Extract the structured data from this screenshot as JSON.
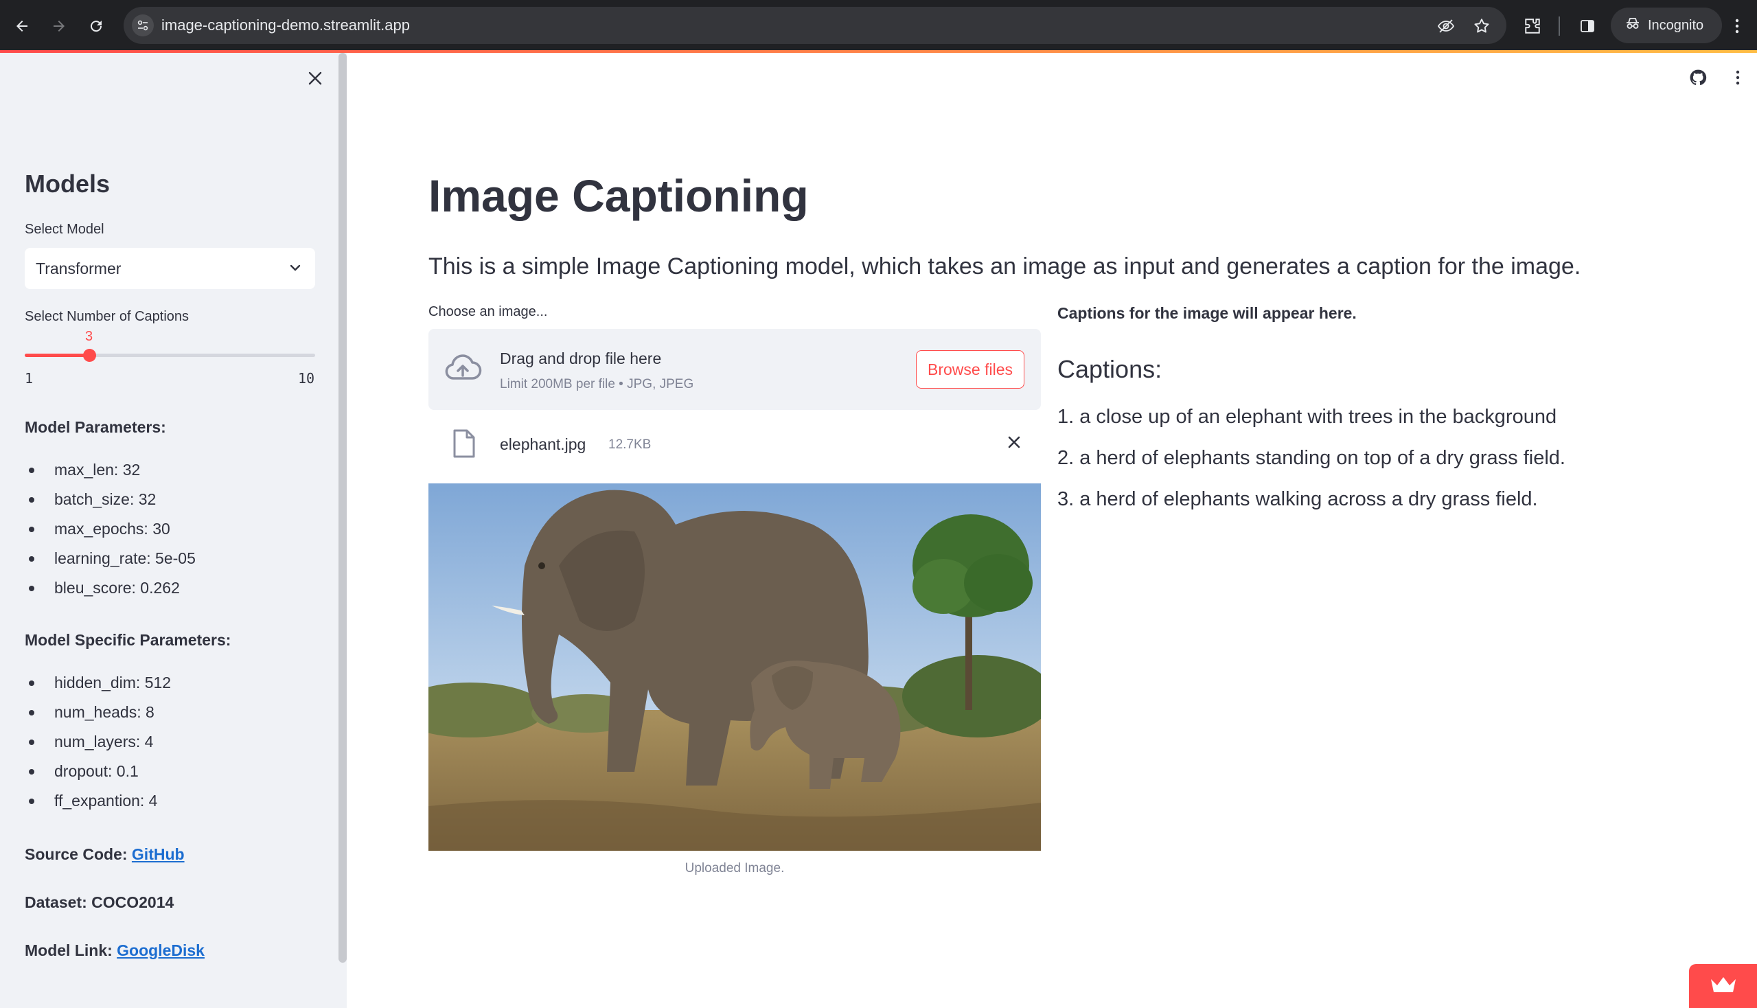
{
  "browser": {
    "url": "image-captioning-demo.streamlit.app",
    "profile_label": "Incognito",
    "icons": [
      "back-arrow-icon",
      "forward-arrow-icon",
      "reload-icon",
      "site-info-icon",
      "eye-off-icon",
      "star-icon",
      "extensions-icon",
      "side-panel-icon",
      "incognito-icon",
      "kebab-menu-icon"
    ]
  },
  "sidebar": {
    "heading": "Models",
    "select_model": {
      "label": "Select Model",
      "value": "Transformer"
    },
    "captions_slider": {
      "label": "Select Number of Captions",
      "value": 3,
      "value_text": "3",
      "min": 1,
      "max": 10,
      "min_text": "1",
      "max_text": "10"
    },
    "model_params": {
      "heading": "Model Parameters:",
      "items": [
        "max_len: 32",
        "batch_size: 32",
        "max_epochs: 30",
        "learning_rate: 5e-05",
        "bleu_score: 0.262"
      ]
    },
    "specific_params": {
      "heading": "Model Specific Parameters:",
      "items": [
        "hidden_dim: 512",
        "num_heads: 8",
        "num_layers: 4",
        "dropout: 0.1",
        "ff_expantion: 4"
      ]
    },
    "source": {
      "label": "Source Code:",
      "link": "GitHub"
    },
    "dataset": {
      "label": "Dataset: COCO2014"
    },
    "model_link": {
      "label": "Model Link:",
      "link": "GoogleDisk"
    }
  },
  "main": {
    "title": "Image Captioning",
    "subtitle": "This is a simple Image Captioning model, which takes an image as input and generates a caption for the image.",
    "uploader": {
      "label": "Choose an image...",
      "drop_text": "Drag and drop file here",
      "limit_text": "Limit 200MB per file • JPG, JPEG",
      "browse_label": "Browse files",
      "file_name": "elephant.jpg",
      "file_size": "12.7KB"
    },
    "image_caption": "Uploaded Image.",
    "captions_note": "Captions for the image will appear here.",
    "captions_heading": "Captions:",
    "captions": [
      "1. a close up of an elephant with trees in the background",
      "2. a herd of elephants standing on top of a dry grass field.",
      "3. a herd of elephants walking across a dry grass field."
    ]
  },
  "colors": {
    "accent": "#ff4b4b",
    "sidebar_bg": "#f0f2f6",
    "text": "#31333f",
    "muted": "#808495",
    "link": "#1c6dd0"
  }
}
